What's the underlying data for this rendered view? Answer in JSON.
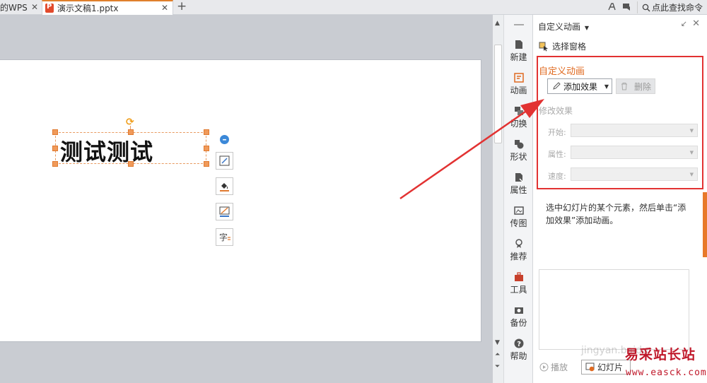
{
  "tabs": {
    "wps": {
      "label": "的WPS"
    },
    "document": {
      "label": "演示文稿1.pptx"
    },
    "close_glyph": "✕",
    "add_glyph": "+"
  },
  "toolbar_right": {
    "find_command": "点此查找命令"
  },
  "slide": {
    "text": "测试测试"
  },
  "sidebar": {
    "items": [
      {
        "label": "新建",
        "icon": "new-doc-icon"
      },
      {
        "label": "动画",
        "icon": "animation-icon"
      },
      {
        "label": "切换",
        "icon": "transition-icon"
      },
      {
        "label": "形状",
        "icon": "shape-icon"
      },
      {
        "label": "属性",
        "icon": "property-icon"
      },
      {
        "label": "传图",
        "icon": "upload-image-icon"
      },
      {
        "label": "推荐",
        "icon": "recommend-icon"
      },
      {
        "label": "工具",
        "icon": "toolbox-icon"
      },
      {
        "label": "备份",
        "icon": "backup-icon"
      },
      {
        "label": "帮助",
        "icon": "help-icon"
      }
    ]
  },
  "panel": {
    "title": "自定义动画",
    "select_pane": "选择窗格",
    "section_title": "自定义动画",
    "add_effect": "添加效果",
    "delete": "删除",
    "modify_heading": "修改效果",
    "fields": {
      "start": "开始:",
      "property": "属性:",
      "speed": "速度:"
    },
    "hint": "选中幻灯片的某个元素，然后单击“添加效果”添加动画。",
    "play": "播放",
    "slideshow": "幻灯片"
  },
  "watermark": {
    "brand": "易采站长站",
    "url": "www.easck.com",
    "faint": "jingyan.baidu"
  },
  "colors": {
    "accent_orange": "#e06a20",
    "highlight_red": "#e23232",
    "watermark_red": "#c0182a"
  }
}
